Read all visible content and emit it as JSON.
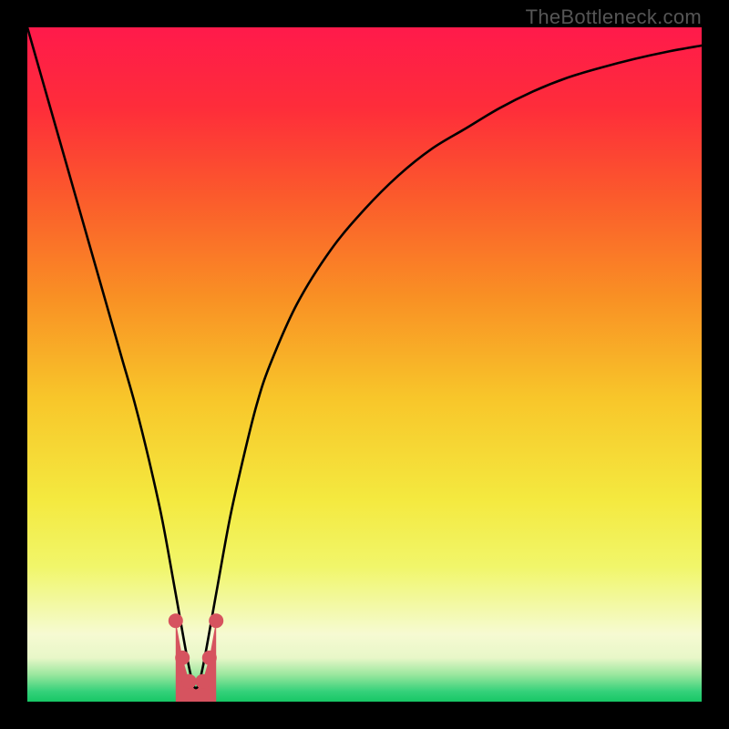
{
  "watermark": {
    "text": "TheBottleneck.com"
  },
  "gradient": {
    "stops": [
      {
        "offset": 0.0,
        "color": "#ff1a4b"
      },
      {
        "offset": 0.12,
        "color": "#fe2d3a"
      },
      {
        "offset": 0.25,
        "color": "#fb5a2c"
      },
      {
        "offset": 0.4,
        "color": "#f99024"
      },
      {
        "offset": 0.55,
        "color": "#f8c62a"
      },
      {
        "offset": 0.7,
        "color": "#f4e93f"
      },
      {
        "offset": 0.8,
        "color": "#f1f66a"
      },
      {
        "offset": 0.86,
        "color": "#f3f9a8"
      },
      {
        "offset": 0.9,
        "color": "#f6fad2"
      },
      {
        "offset": 0.935,
        "color": "#e8f7c8"
      },
      {
        "offset": 0.96,
        "color": "#9ae79e"
      },
      {
        "offset": 0.985,
        "color": "#34d17a"
      },
      {
        "offset": 1.0,
        "color": "#17c765"
      }
    ]
  },
  "chart_data": {
    "type": "line",
    "title": "",
    "xlabel": "",
    "ylabel": "",
    "ylim": [
      0,
      100
    ],
    "xlim": [
      0,
      100
    ],
    "series": [
      {
        "name": "bottleneck-curve",
        "x": [
          0,
          2,
          4,
          6,
          8,
          10,
          12,
          14,
          16,
          18,
          20,
          22,
          24,
          25,
          26,
          28,
          30,
          32,
          34,
          36,
          40,
          45,
          50,
          55,
          60,
          65,
          70,
          75,
          80,
          85,
          90,
          95,
          100
        ],
        "values": [
          100,
          93,
          86,
          79,
          72,
          65,
          58,
          51,
          44,
          36,
          27,
          16,
          5,
          2,
          5,
          16,
          27,
          36,
          44,
          50,
          59,
          67,
          73,
          78,
          82,
          85,
          88,
          90.5,
          92.5,
          94,
          95.3,
          96.4,
          97.3
        ]
      }
    ],
    "markers": {
      "name": "valley-markers",
      "x": [
        22.0,
        23.0,
        24.0,
        26.0,
        27.0,
        28.0
      ],
      "values": [
        12.0,
        6.5,
        3.0,
        3.0,
        6.5,
        12.0
      ],
      "color": "#d6535f",
      "radius_px": 8
    },
    "valley_fill": {
      "x": [
        22.0,
        23.0,
        24.0,
        25.0,
        26.0,
        27.0,
        28.0
      ],
      "values": [
        12.0,
        6.5,
        3.0,
        2.0,
        3.0,
        6.5,
        12.0
      ],
      "color": "#d6535f"
    }
  }
}
